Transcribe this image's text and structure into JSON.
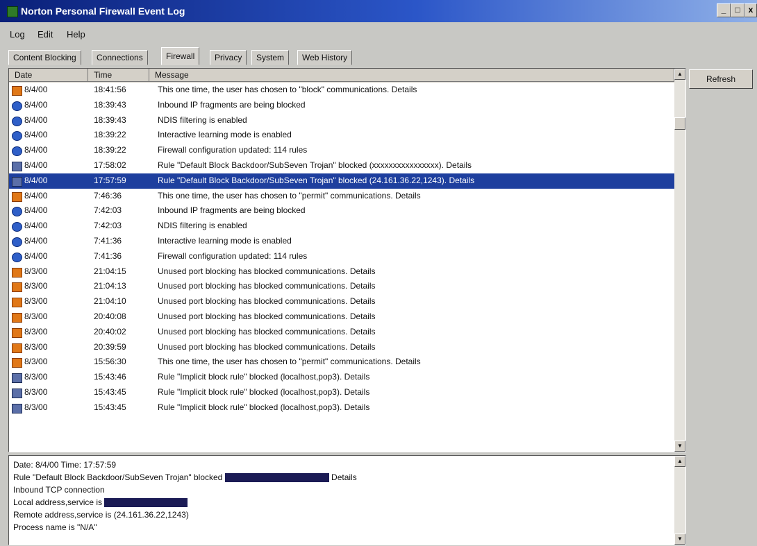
{
  "window": {
    "title": "Norton Personal Firewall Event Log"
  },
  "menu": [
    "Log",
    "Edit",
    "Help"
  ],
  "tabs": [
    "Content Blocking",
    "Connections",
    "Firewall",
    "Privacy",
    "System",
    "Web History"
  ],
  "active_tab": "Firewall",
  "columns": {
    "date": "Date",
    "time": "Time",
    "message": "Message"
  },
  "rows": [
    {
      "icon": "warn",
      "date": "8/4/00",
      "time": "18:41:56",
      "message": "This one time, the user has chosen to \"block\" communications.  Details"
    },
    {
      "icon": "info",
      "date": "8/4/00",
      "time": "18:39:43",
      "message": "Inbound IP fragments are being blocked"
    },
    {
      "icon": "info",
      "date": "8/4/00",
      "time": "18:39:43",
      "message": "NDIS filtering is enabled"
    },
    {
      "icon": "info",
      "date": "8/4/00",
      "time": "18:39:22",
      "message": "Interactive learning mode is enabled"
    },
    {
      "icon": "info",
      "date": "8/4/00",
      "time": "18:39:22",
      "message": "Firewall configuration updated: 114 rules"
    },
    {
      "icon": "rule",
      "date": "8/4/00",
      "time": "17:58:02",
      "message": "Rule \"Default Block Backdoor/SubSeven Trojan\" blocked (xxxxxxxxxxxxxxxx).  Details"
    },
    {
      "icon": "rule",
      "date": "8/4/00",
      "time": "17:57:59",
      "message": "Rule \"Default Block Backdoor/SubSeven Trojan\" blocked (24.161.36.22,1243).  Details",
      "selected": true
    },
    {
      "icon": "warn",
      "date": "8/4/00",
      "time": "7:46:36",
      "message": "This one time, the user has chosen to \"permit\" communications.  Details"
    },
    {
      "icon": "info",
      "date": "8/4/00",
      "time": "7:42:03",
      "message": "Inbound IP fragments are being blocked"
    },
    {
      "icon": "info",
      "date": "8/4/00",
      "time": "7:42:03",
      "message": "NDIS filtering is enabled"
    },
    {
      "icon": "info",
      "date": "8/4/00",
      "time": "7:41:36",
      "message": "Interactive learning mode is enabled"
    },
    {
      "icon": "info",
      "date": "8/4/00",
      "time": "7:41:36",
      "message": "Firewall configuration updated: 114 rules"
    },
    {
      "icon": "warn",
      "date": "8/3/00",
      "time": "21:04:15",
      "message": "Unused port blocking has blocked communications.  Details"
    },
    {
      "icon": "warn",
      "date": "8/3/00",
      "time": "21:04:13",
      "message": "Unused port blocking has blocked communications.  Details"
    },
    {
      "icon": "warn",
      "date": "8/3/00",
      "time": "21:04:10",
      "message": "Unused port blocking has blocked communications.  Details"
    },
    {
      "icon": "warn",
      "date": "8/3/00",
      "time": "20:40:08",
      "message": "Unused port blocking has blocked communications.  Details"
    },
    {
      "icon": "warn",
      "date": "8/3/00",
      "time": "20:40:02",
      "message": "Unused port blocking has blocked communications.  Details"
    },
    {
      "icon": "warn",
      "date": "8/3/00",
      "time": "20:39:59",
      "message": "Unused port blocking has blocked communications.  Details"
    },
    {
      "icon": "warn",
      "date": "8/3/00",
      "time": "15:56:30",
      "message": "This one time, the user has chosen to \"permit\" communications.  Details"
    },
    {
      "icon": "rule",
      "date": "8/3/00",
      "time": "15:43:46",
      "message": "Rule \"Implicit block rule\" blocked (localhost,pop3).  Details"
    },
    {
      "icon": "rule",
      "date": "8/3/00",
      "time": "15:43:45",
      "message": "Rule \"Implicit block rule\" blocked (localhost,pop3).  Details"
    },
    {
      "icon": "rule",
      "date": "8/3/00",
      "time": "15:43:45",
      "message": "Rule \"Implicit block rule\" blocked (localhost,pop3).  Details"
    }
  ],
  "refresh_label": "Refresh",
  "details": {
    "line1": "Date: 8/4/00  Time: 17:57:59",
    "line2a": "Rule \"Default Block Backdoor/SubSeven Trojan\" blocked",
    "line2b": "Details",
    "line3": "Inbound TCP connection",
    "line4": "Local address,service is",
    "line5": "Remote address,service is (24.161.36.22,1243)",
    "line6": "Process name is \"N/A\""
  },
  "colors": {
    "selection": "#1e3f9e",
    "title_bar": "#0a1f78"
  }
}
